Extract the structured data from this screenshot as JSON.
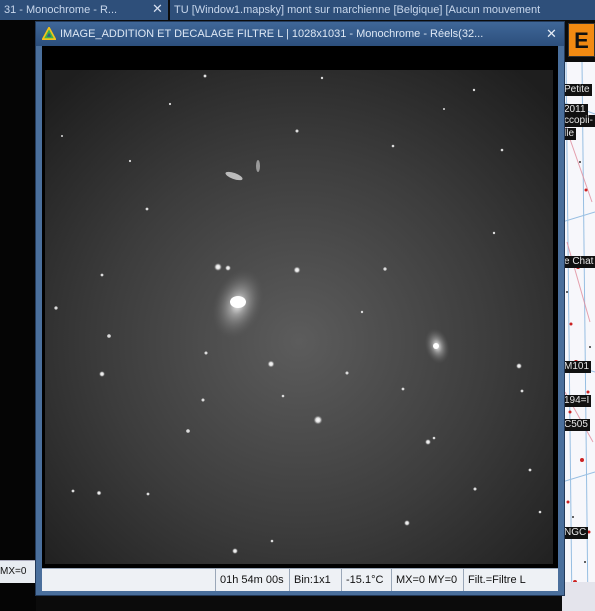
{
  "background": {
    "tabs": [
      {
        "label": "31 - Monochrome - R..."
      },
      {
        "label": "TU [Window1.mapsky]   mont sur marchienne [Belgique] [Aucun mouvement"
      }
    ],
    "close_glyphs": [
      "✕",
      "✕"
    ],
    "left_window_status": "MX=0",
    "orange_button_label": "E",
    "map_labels": [
      "Petite",
      "2011",
      "ccopii-",
      "lle",
      "e Chat",
      "M101",
      "194=I",
      "C505",
      "NGC"
    ]
  },
  "window": {
    "title": "IMAGE_ADDITION ET DECALAGE FILTRE L  |  1028x1031 - Monochrome - Réels(32...",
    "close_glyph": "✕"
  },
  "statusbar": {
    "exposure": "01h 54m 00s",
    "binning": "Bin:1x1",
    "temperature": "-15.1°C",
    "mouse_position": "MX=0 MY=0",
    "filter": "Filt.=Filtre L"
  },
  "colors": {
    "title_bar": "#2f5380",
    "frame": "#4a6f9c",
    "orange_accent": "#f28a12",
    "status_bg": "#eef1f5"
  }
}
